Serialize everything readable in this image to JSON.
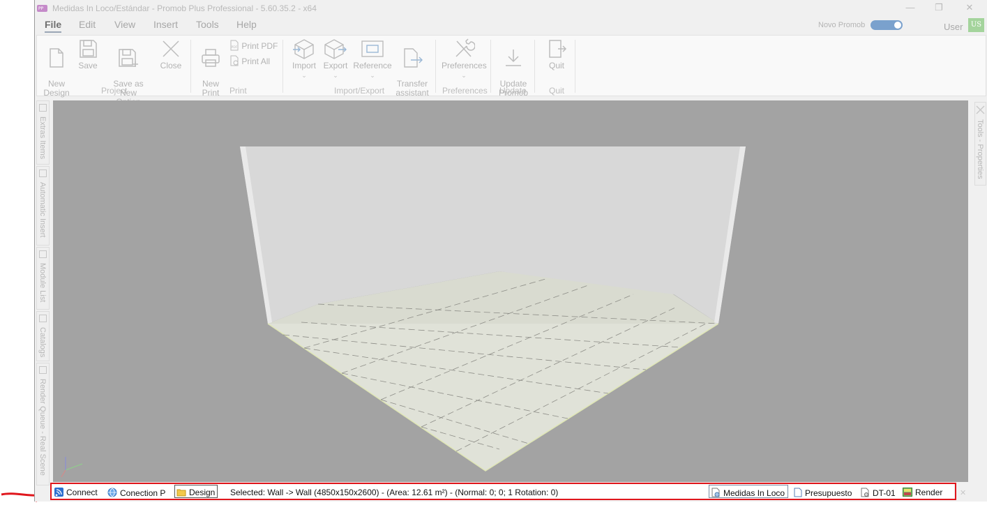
{
  "window": {
    "title": "Medidas In Loco/Estándar - Promob Plus Professional - 5.60.35.2 - x64",
    "minimize": "—",
    "restore": "❐",
    "close": "✕"
  },
  "menu": [
    "File",
    "Edit",
    "View",
    "Insert",
    "Tools",
    "Help"
  ],
  "header": {
    "novo_label": "Novo Promob",
    "toggle_on": true,
    "user_label": "User",
    "avatar": "US"
  },
  "ribbon": {
    "project": {
      "new_design": "New\nDesign",
      "save": "Save",
      "save_as_new": "Save as New\nOption",
      "close": "Close",
      "label": "Project"
    },
    "print": {
      "new_print": "New\nPrint",
      "print_pdf": "Print PDF",
      "print_all": "Print All",
      "label": "Print"
    },
    "import_export": {
      "import": "Import",
      "export": "Export",
      "reference": "Reference",
      "transfer": "Transfer\nassistant",
      "label": "Import/Export"
    },
    "preferences": {
      "button": "Preferences",
      "label": "Preferences"
    },
    "update": {
      "button": "Update\nPromob",
      "label": "Update"
    },
    "quit": {
      "button": "Quit",
      "label": "Quit"
    }
  },
  "left_tabs": [
    "Extras Items",
    "Automatic Insert",
    "Module List",
    "Catalogs",
    "Render Queue - Real Scene"
  ],
  "right_tab": "Tools - Properties",
  "statusbar": {
    "connect": "Connect",
    "connection": "Conection P",
    "design": "Design",
    "selection": "Selected: Wall -> Wall (4850x150x2600) - (Area: 12.61 m²) - (Normal: 0; 0; 1 Rotation: 0)",
    "medidas": "Medidas In Loco",
    "presupuesto": "Presupuesto",
    "dt": "DT-01",
    "render": "Render"
  },
  "colors": {
    "viewport_bg": "#a3a3a3",
    "highlight": "#e0161c",
    "toggle": "#7aa1cd",
    "avatar": "#a4d49c"
  }
}
